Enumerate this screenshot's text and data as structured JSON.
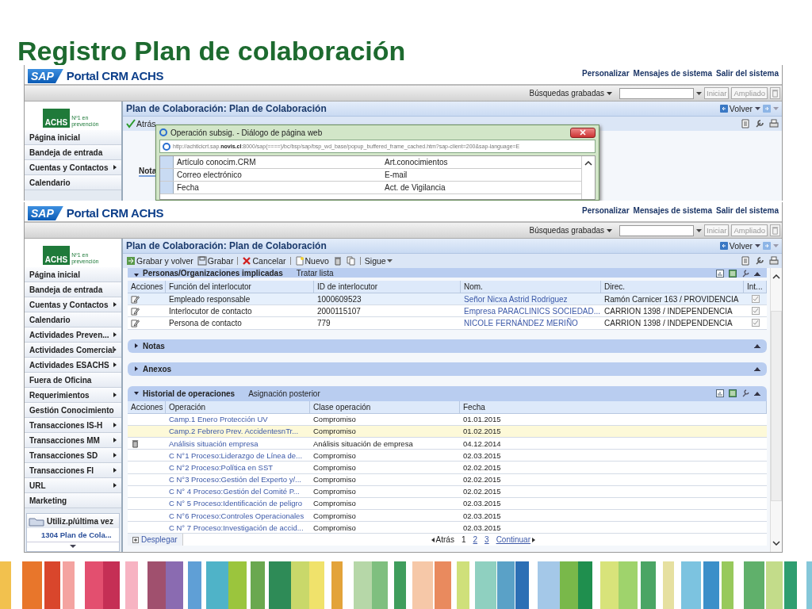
{
  "slide_title": "Registro Plan de colaboración",
  "back_screen": {
    "header": {
      "logo": "SAP",
      "brand": "Portal CRM ACHS",
      "links": [
        "Personalizar",
        "Mensajes de sistema",
        "Salir del sistema"
      ]
    },
    "search": {
      "label": "Búsquedas grabadas",
      "buttons": [
        "Iniciar",
        "Ampliado"
      ]
    },
    "company": {
      "logo": "ACHS",
      "tagline": "Nº1 en prevención"
    },
    "page_title": "Plan de Colaboración: Plan de Colaboración",
    "back_button": "Volver",
    "toolbar": [
      {
        "kind": "back",
        "label": "Atrás",
        "divider": false
      }
    ],
    "sidebar": [
      {
        "label": "Página inicial",
        "submenu": false
      },
      {
        "label": "Bandeja de entrada",
        "submenu": false
      },
      {
        "label": "Cuentas y Contactos",
        "submenu": true
      },
      {
        "label": "Calendario",
        "submenu": false
      }
    ],
    "section_label": "Nota",
    "dialog": {
      "title": "Operación subsig. - Diálogo de página web",
      "url": "http://achtlcicrt.sap.**novis.cl**:8000/sap(====)/bc/bsp/sap/bsp_wd_base/popup_buffered_frame_cached.htm?sap-client=200&sap-language=E",
      "rows": [
        {
          "column_1": "Artículo conocim.CRM",
          "column_2": "Art.conocimientos"
        },
        {
          "column_1": "Correo electrónico",
          "column_2": "E-mail"
        },
        {
          "column_1": "Fecha",
          "column_2": "Act. de Vigilancia"
        }
      ]
    }
  },
  "front_screen": {
    "header": {
      "logo": "SAP",
      "brand": "Portal CRM ACHS",
      "links": [
        "Personalizar",
        "Mensajes de sistema",
        "Salir del sistema"
      ]
    },
    "search": {
      "label": "Búsquedas grabadas",
      "buttons": [
        "Iniciar",
        "Ampliado"
      ]
    },
    "company": {
      "logo": "ACHS",
      "tagline": "Nº1 en prevención"
    },
    "page_title": "Plan de Colaboración: Plan de Colaboración",
    "back_button": "Volver",
    "toolbar": [
      {
        "kind": "save-back",
        "label": "Grabar y volver",
        "divider": false
      },
      {
        "kind": "save",
        "label": "Grabar",
        "divider": false
      },
      {
        "kind": "cancel",
        "label": "Cancelar",
        "divider": true
      },
      {
        "kind": "new",
        "label": "Nuevo",
        "divider": true
      },
      {
        "kind": "delete",
        "divider": false
      },
      {
        "kind": "copy",
        "divider": false
      },
      {
        "kind": "more",
        "label": "Sigue",
        "divider": true
      }
    ],
    "sidebar": [
      {
        "label": "Página inicial",
        "submenu": false
      },
      {
        "label": "Bandeja de entrada",
        "submenu": false
      },
      {
        "label": "Cuentas y Contactos",
        "submenu": true
      },
      {
        "label": "Calendario",
        "submenu": false
      },
      {
        "label": "Actividades Preven...",
        "submenu": true
      },
      {
        "label": "Actividades Comercial",
        "submenu": true
      },
      {
        "label": "Actividades ESACHS",
        "submenu": true
      },
      {
        "label": "Fuera de Oficina",
        "submenu": false
      },
      {
        "label": "Requerimientos",
        "submenu": true
      },
      {
        "label": "Gestión Conocimiento",
        "submenu": false
      },
      {
        "label": "Transacciones IS-H",
        "submenu": true
      },
      {
        "label": "Transacciones MM",
        "submenu": true
      },
      {
        "label": "Transacciones SD",
        "submenu": true
      },
      {
        "label": "Transacciones FI",
        "submenu": true
      },
      {
        "label": "URL",
        "submenu": true
      },
      {
        "label": "Marketing",
        "submenu": false
      }
    ],
    "recent": {
      "title": "Utiliz.p/última vez",
      "items": [
        "1304 Plan de Cola..."
      ]
    },
    "sections": [
      {
        "kind": "table",
        "title": "Personas/Organizaciones implicadas",
        "action": "Tratar lista",
        "expanded": true,
        "columns": [
          "Acciones",
          "Función del interlocutor",
          "ID de interlocutor",
          "Nom.",
          "Direc.",
          "Int..."
        ],
        "rows": [
          {
            "kind": "edit",
            "selected": true,
            "checked": true,
            "cells": [
              "",
              "Empleado responsable",
              "1000609523",
              "Señor Nicxa Astrid Rodriguez",
              "Ramón Carnicer 163 / PROVIDENCIA"
            ]
          },
          {
            "kind": "edit",
            "selected": false,
            "checked": true,
            "cells": [
              "",
              "Interlocutor de contacto",
              "2000115107",
              "Empresa PARACLINICS SOCIEDAD...",
              "CARRION 1398 / INDEPENDENCIA"
            ]
          },
          {
            "kind": "edit",
            "selected": false,
            "checked": true,
            "cells": [
              "",
              "Persona de contacto",
              "779",
              "NICOLE FERNÁNDEZ MERIÑO",
              "CARRION 1398 / INDEPENDENCIA"
            ]
          }
        ]
      },
      {
        "kind": "bar",
        "title": "Notas",
        "expanded": false
      },
      {
        "kind": "bar",
        "title": "Anexos",
        "expanded": false
      },
      {
        "kind": "history",
        "title": "Historial de operaciones",
        "action": "Asignación posterior",
        "expanded": true,
        "columns": [
          "Acciones",
          "Operación",
          "Clase operación",
          "Fecha"
        ],
        "rows": [
          {
            "selected": false,
            "cells": [
              "",
              "Camp.1 Enero Protección UV",
              "Compromiso",
              "01.01.2015"
            ]
          },
          {
            "selected": true,
            "cells": [
              "",
              "Camp.2 Febrero Prev. AccidentesnTr...",
              "Compromiso",
              "01.02.2015"
            ]
          },
          {
            "kind": "delete",
            "selected": false,
            "cells": [
              "",
              "Análisis situación empresa",
              "Análisis situación de empresa",
              "04.12.2014"
            ]
          },
          {
            "selected": false,
            "cells": [
              "",
              "C N°1 Proceso:Liderazgo de Línea de...",
              "Compromiso",
              "02.03.2015"
            ]
          },
          {
            "selected": false,
            "cells": [
              "",
              "C N°2 Proceso:Política en SST",
              "Compromiso",
              "02.02.2015"
            ]
          },
          {
            "selected": false,
            "cells": [
              "",
              "C N°3 Proceso:Gestión del Experto y/...",
              "Compromiso",
              "02.02.2015"
            ]
          },
          {
            "selected": false,
            "cells": [
              "",
              "C N° 4 Proceso:Gestión del Comité P...",
              "Compromiso",
              "02.02.2015"
            ]
          },
          {
            "selected": false,
            "cells": [
              "",
              "C N° 5 Proceso:Identificación de peligro",
              "Compromiso",
              "02.03.2015"
            ]
          },
          {
            "selected": false,
            "cells": [
              "",
              "C N°6 Proceso:Controles Operacionales",
              "Compromiso",
              "02.03.2015"
            ]
          },
          {
            "selected": false,
            "cells": [
              "",
              "C N° 7 Proceso:Investigación de accid...",
              "Compromiso",
              "02.03.2015"
            ]
          }
        ],
        "expand": "Desplegar",
        "pager": {
          "back": "Atrás",
          "pages": [
            {
              "label": "1",
              "selected": true
            },
            {
              "label": "2",
              "selected": false
            },
            {
              "label": "3",
              "selected": false
            }
          ],
          "next": "Continuar"
        }
      }
    ]
  }
}
